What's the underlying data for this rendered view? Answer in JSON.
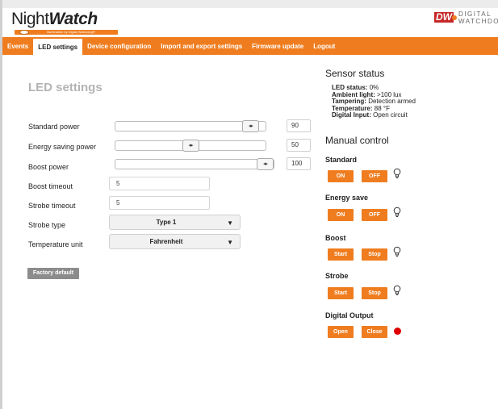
{
  "brand": {
    "logo_word_light": "Night",
    "logo_word_bold": "Watch",
    "logo_tagline": "Illumination by Digital Watchdog®",
    "partner_logo_mark": "DW",
    "partner_logo_text_1": "DIGITAL",
    "partner_logo_text_2": "WATCHDOG"
  },
  "nav": {
    "tabs": [
      {
        "label": "Events"
      },
      {
        "label": "LED settings"
      },
      {
        "label": "Device configuration"
      },
      {
        "label": "Import and export settings"
      },
      {
        "label": "Firmware update"
      },
      {
        "label": "Logout"
      }
    ],
    "active_tab": "LED settings"
  },
  "led_settings": {
    "title": "LED settings",
    "standard_power": {
      "label": "Standard power",
      "value": "90",
      "level": 0.9
    },
    "energy_saving_power": {
      "label": "Energy saving power",
      "value": "50",
      "level": 0.5
    },
    "boost_power": {
      "label": "Boost power",
      "value": "100",
      "level": 1.0
    },
    "boost_timeout": {
      "label": "Boost timeout",
      "value": "5"
    },
    "strobe_timeout": {
      "label": "Strobe timeout",
      "value": "5"
    },
    "strobe_type": {
      "label": "Strobe type",
      "value": "Type 1"
    },
    "temperature_unit": {
      "label": "Temperature unit",
      "value": "Fahrenheit"
    },
    "factory_default_label": "Factory default",
    "slider_thumb_glyph": "◂▸"
  },
  "sensor_status": {
    "title": "Sensor status",
    "items": [
      {
        "key": "LED status:",
        "value": "0%"
      },
      {
        "key": "Ambient light:",
        "value": ">100 lux"
      },
      {
        "key": "Tampering:",
        "value": "Detection armed"
      },
      {
        "key": "Temperature:",
        "value": "88 °F"
      },
      {
        "key": "Digital Input:",
        "value": "Open circuit"
      }
    ]
  },
  "manual_control": {
    "title": "Manual control",
    "standard": {
      "label": "Standard",
      "on": "ON",
      "off": "OFF"
    },
    "energy_save": {
      "label": "Energy save",
      "on": "ON",
      "off": "OFF"
    },
    "boost": {
      "label": "Boost",
      "start": "Start",
      "stop": "Stop"
    },
    "strobe": {
      "label": "Strobe",
      "start": "Start",
      "stop": "Stop"
    },
    "digital_output": {
      "label": "Digital Output",
      "open": "Open",
      "close": "Close",
      "indicator_color": "#e00000"
    }
  },
  "colors": {
    "accent": "#ef7d1f",
    "title_gray": "#b4b4b4",
    "factory_button": "#8c8c8c"
  },
  "icons": [
    "slider-thumb-icon",
    "chevron-down-icon",
    "lightbulb-icon",
    "red-status-dot-icon"
  ]
}
